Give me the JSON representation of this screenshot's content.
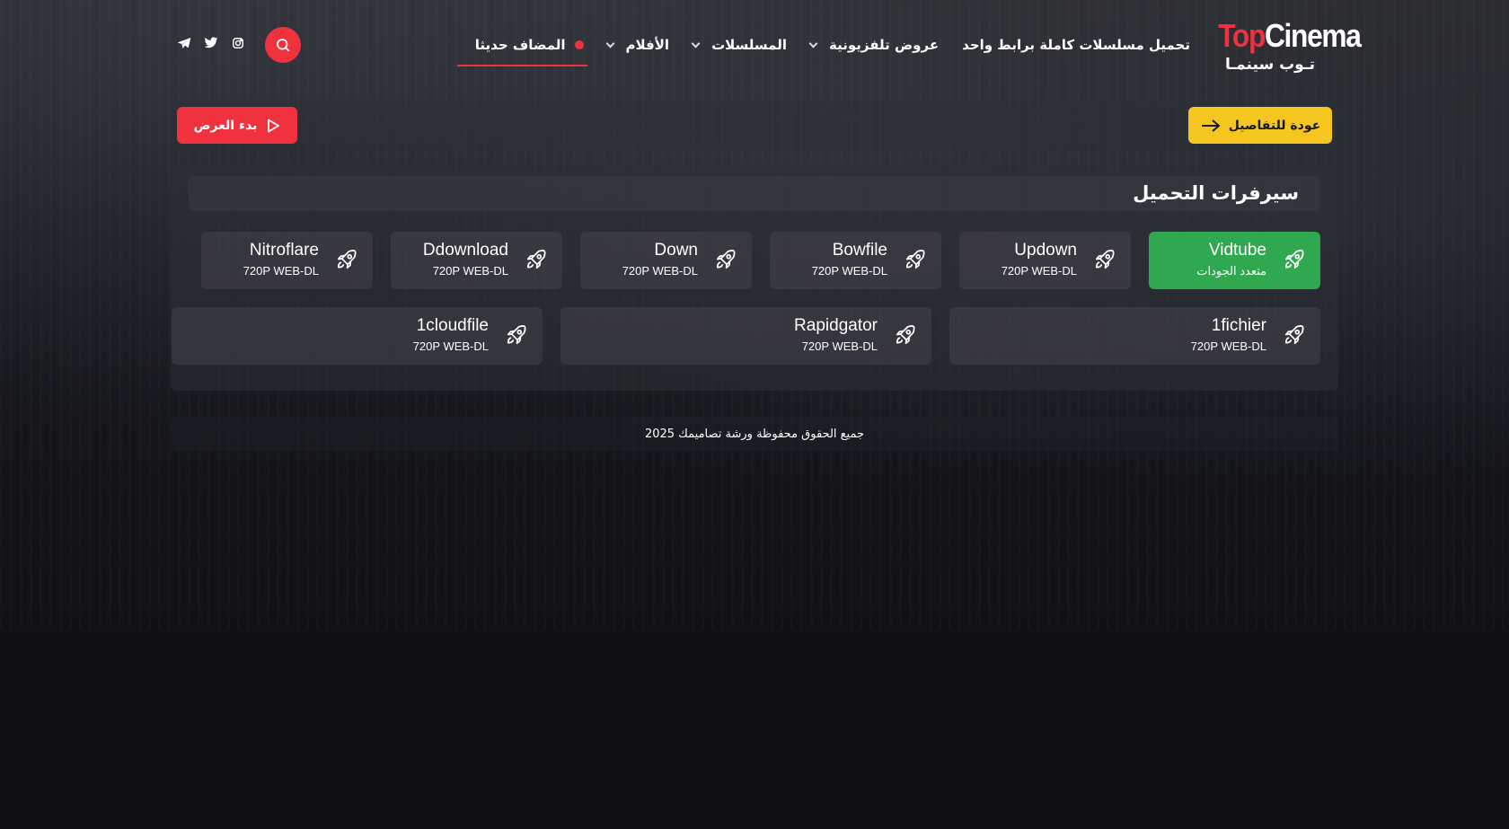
{
  "logo": {
    "en_part1": "Top",
    "en_part2": "Cinema",
    "ar": "تـوب سينمـا"
  },
  "nav": {
    "items": [
      {
        "label": "المضاف حديثا",
        "active": true,
        "dropdown": false
      },
      {
        "label": "الأفلام",
        "active": false,
        "dropdown": true
      },
      {
        "label": "المسلسلات",
        "active": false,
        "dropdown": true
      },
      {
        "label": "عروض تلفزيونية",
        "active": false,
        "dropdown": true
      },
      {
        "label": "تحميل مسلسلات كاملة برابط واحد",
        "active": false,
        "dropdown": false
      }
    ]
  },
  "social": [
    "instagram-icon",
    "twitter-icon",
    "telegram-icon"
  ],
  "actions": {
    "back_label": "عودة للتفاصيل",
    "watch_label": "بدء العرض"
  },
  "servers": {
    "title": "سيرفرات التحميل",
    "row1": [
      {
        "name": "Vidtube",
        "quality": "متعدد الجودات",
        "highlight": true
      },
      {
        "name": "Updown",
        "quality": "720P WEB-DL",
        "highlight": false
      },
      {
        "name": "Bowfile",
        "quality": "720P WEB-DL",
        "highlight": false
      },
      {
        "name": "Down",
        "quality": "720P WEB-DL",
        "highlight": false
      },
      {
        "name": "Ddownload",
        "quality": "720P WEB-DL",
        "highlight": false
      },
      {
        "name": "Nitroflare",
        "quality": "720P WEB-DL",
        "highlight": false
      }
    ],
    "row2": [
      {
        "name": "1fichier",
        "quality": "720P WEB-DL",
        "highlight": false
      },
      {
        "name": "Rapidgator",
        "quality": "720P WEB-DL",
        "highlight": false
      },
      {
        "name": "1cloudfile",
        "quality": "720P WEB-DL",
        "highlight": false
      }
    ]
  },
  "footer": {
    "text": "جميع الحقوق محفوظة ورشة تصاميمك 2025"
  },
  "colors": {
    "accent": "#f0323f",
    "yellow": "#f5c61f",
    "green": "#2fa84f",
    "background": "#0f1117"
  }
}
